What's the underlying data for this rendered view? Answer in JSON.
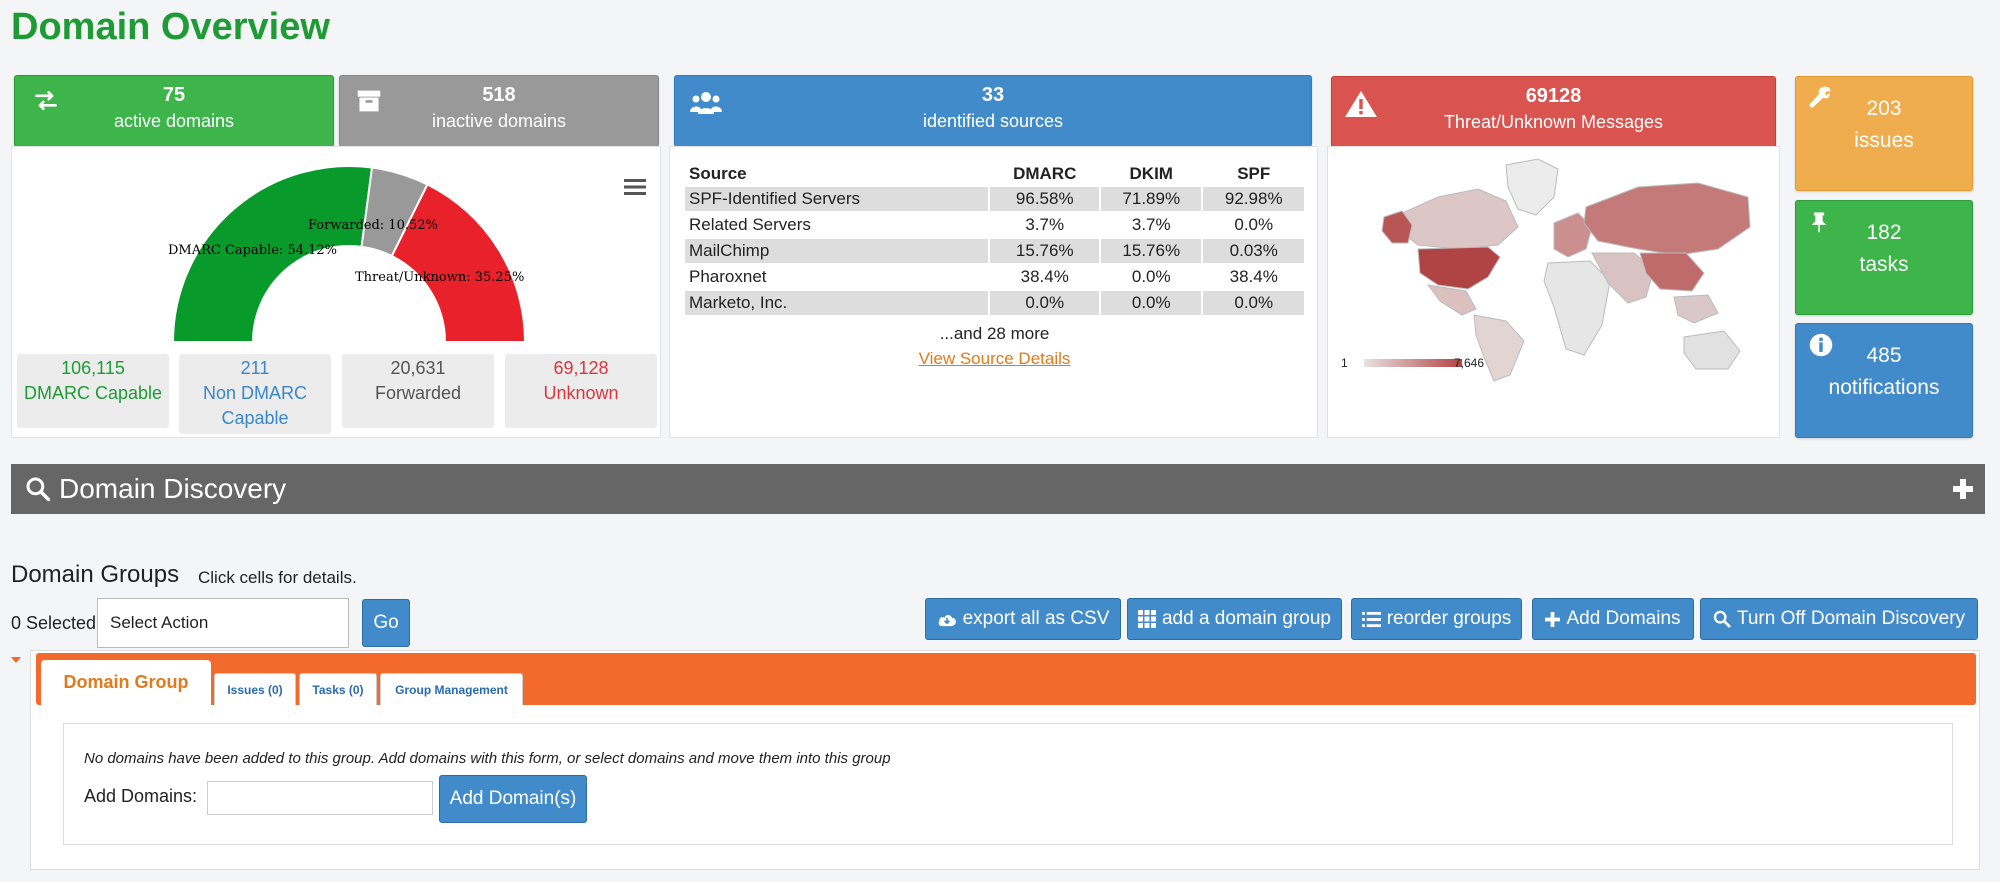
{
  "page": {
    "title": "Domain Overview"
  },
  "cards": {
    "active": {
      "count": "75",
      "label": "active domains",
      "icon": "exchange-arrows-icon"
    },
    "inactive": {
      "count": "518",
      "label": "inactive domains",
      "icon": "archive-icon"
    },
    "sources": {
      "count": "33",
      "label": "identified sources",
      "icon": "users-icon"
    },
    "threat": {
      "count": "69128",
      "label": "Threat/Unknown Messages",
      "icon": "warning-icon"
    },
    "issues": {
      "count": "203",
      "label": "issues",
      "icon": "wrench-icon"
    },
    "tasks": {
      "count": "182",
      "label": "tasks",
      "icon": "pin-icon"
    },
    "notifications": {
      "count": "485",
      "label": "notifications",
      "icon": "info-icon"
    }
  },
  "gauge": {
    "slices": [
      {
        "label": "DMARC Capable: 54.12%",
        "value": 54.12,
        "color": "#089a2a"
      },
      {
        "label": "Forwarded: 10.52%",
        "value": 10.52,
        "color": "#999999"
      },
      {
        "label": "Threat/Unknown: 35.25%",
        "value": 35.25,
        "color": "#e8212b"
      }
    ]
  },
  "summary": [
    {
      "value": "106,115",
      "label": "DMARC Capable",
      "color": "#1e9b35"
    },
    {
      "value": "211",
      "label": "Non DMARC Capable",
      "color": "#3a86c8"
    },
    {
      "value": "20,631",
      "label": "Forwarded",
      "color": "#555555"
    },
    {
      "value": "69,128",
      "label": "Unknown",
      "color": "#d9363e"
    }
  ],
  "sources_table": {
    "headers": [
      "Source",
      "DMARC",
      "DKIM",
      "SPF"
    ],
    "rows": [
      [
        "SPF-Identified Servers",
        "96.58%",
        "71.89%",
        "92.98%"
      ],
      [
        "Related Servers",
        "3.7%",
        "3.7%",
        "0.0%"
      ],
      [
        "MailChimp",
        "15.76%",
        "15.76%",
        "0.03%"
      ],
      [
        "Pharoxnet",
        "38.4%",
        "0.0%",
        "38.4%"
      ],
      [
        "Marketo, Inc.",
        "0.0%",
        "0.0%",
        "0.0%"
      ]
    ],
    "more": "...and 28 more",
    "link": "View Source Details"
  },
  "map": {
    "legend_min": "1",
    "legend_max": "7,646"
  },
  "discovery": {
    "title": "Domain Discovery"
  },
  "groups": {
    "title": "Domain Groups",
    "hint": "Click cells for details.",
    "selected": "0 Selected",
    "action": "Select Action",
    "go": "Go",
    "buttons": {
      "export": "export all as CSV",
      "add_group": "add a domain group",
      "reorder": "reorder groups",
      "add_domains": "Add Domains",
      "turn_off": "Turn Off Domain Discovery"
    },
    "tabs": {
      "main": "Domain Group",
      "issues": "Issues (0)",
      "tasks": "Tasks (0)",
      "mgmt": "Group Management"
    },
    "empty_msg": "No domains have been added to this group. Add domains with this form, or select domains and move them into this group",
    "add_label": "Add Domains:",
    "add_btn": "Add Domain(s)"
  }
}
